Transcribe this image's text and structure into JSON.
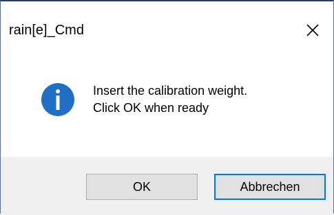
{
  "window": {
    "title": "rain[e]_Cmd",
    "close_glyph": "close-icon"
  },
  "message": {
    "icon": "info-icon",
    "icon_color": "#1f6fc5",
    "line1": "Insert the calibration weight.",
    "line2": "Click OK when ready"
  },
  "buttons": {
    "ok_label": "OK",
    "cancel_label": "Abbrechen",
    "default_button": "cancel",
    "focus_color": "#0078d7"
  }
}
